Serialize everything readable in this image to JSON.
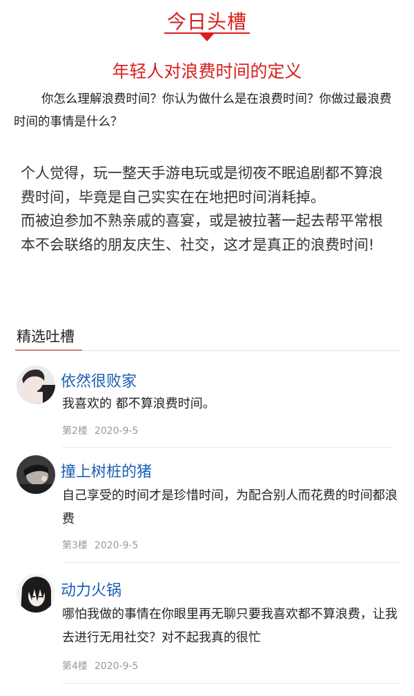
{
  "header": {
    "title": "今日头槽"
  },
  "topic": {
    "title": "年轻人对浪费时间的定义",
    "question": "你怎么理解浪费时间？你认为做什么是在浪费时间？你做过最浪费时间的事情是什么？"
  },
  "opinion": {
    "paragraph1": "个人觉得，玩一整天手游电玩或是彻夜不眠追剧都不算浪费时间，毕竟是自己实实在在地把时间消耗掉。",
    "paragraph2": "而被迫参加不熟亲戚的喜宴，或是被拉著一起去帮平常根本不会联络的朋友庆生、社交，这才是真正的浪费时间!"
  },
  "section": {
    "title": "精选吐槽"
  },
  "comments": [
    {
      "name": "依然很败家",
      "text": "我喜欢的 都不算浪费时间。",
      "floor": "第2楼",
      "date": "2020-9-5"
    },
    {
      "name": "撞上树桩的猪",
      "text": "自己享受的时间才是珍惜时间，为配合别人而花费的时间都浪费",
      "floor": "第3楼",
      "date": "2020-9-5"
    },
    {
      "name": "动力火锅",
      "text": "哪怕我做的事情在你眼里再无聊只要我喜欢都不算浪费，让我去进行无用社交？对不起我真的很忙",
      "floor": "第4楼",
      "date": "2020-9-5"
    }
  ]
}
